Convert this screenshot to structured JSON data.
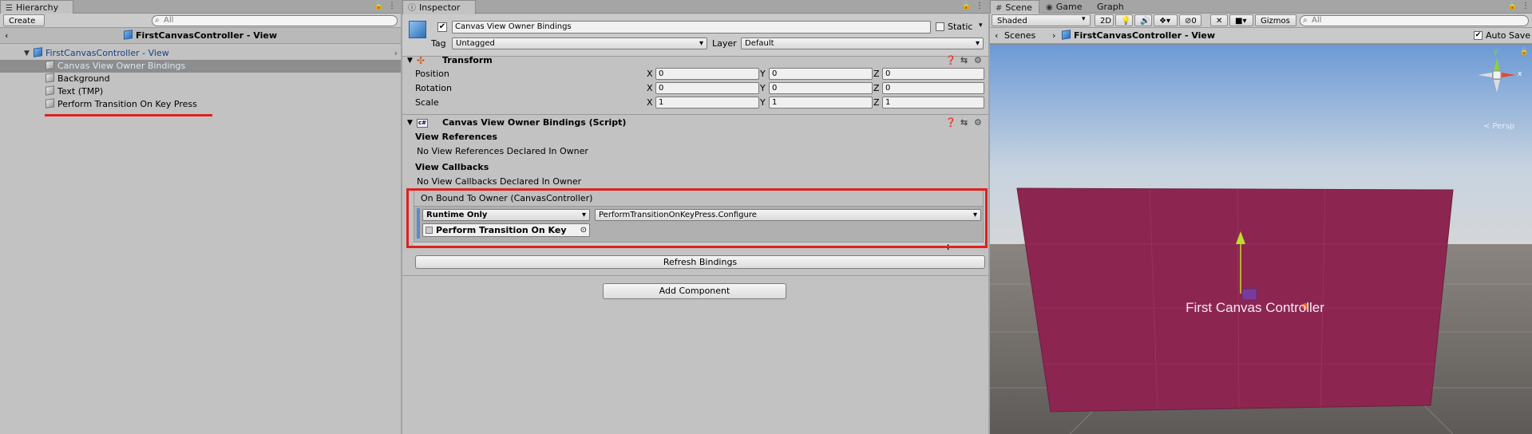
{
  "hierarchy": {
    "tab_label": "Hierarchy",
    "create_label": "Create",
    "search_placeholder": "All",
    "breadcrumb": "FirstCanvasController - View",
    "rows": [
      {
        "label": "FirstCanvasController - View"
      },
      {
        "label": "Canvas View Owner Bindings"
      },
      {
        "label": "Background"
      },
      {
        "label": "Text (TMP)"
      },
      {
        "label": "Perform Transition On Key Press"
      }
    ]
  },
  "inspector": {
    "tab_label": "Inspector",
    "object_name": "Canvas View Owner Bindings",
    "static_label": "Static",
    "tag_label": "Tag",
    "tag_value": "Untagged",
    "layer_label": "Layer",
    "layer_value": "Default",
    "transform": {
      "title": "Transform",
      "position_label": "Position",
      "rotation_label": "Rotation",
      "scale_label": "Scale",
      "x": "X",
      "y": "Y",
      "z": "Z",
      "position": [
        "0",
        "0",
        "0"
      ],
      "rotation": [
        "0",
        "0",
        "0"
      ],
      "scale": [
        "1",
        "1",
        "1"
      ]
    },
    "script": {
      "title": "Canvas View Owner Bindings (Script)",
      "view_refs_header": "View References",
      "view_refs_text": "No View References Declared In Owner",
      "view_callbacks_header": "View Callbacks",
      "view_callbacks_text": "No View Callbacks Declared In Owner",
      "event_title": "On Bound To Owner (CanvasController)",
      "runtime_value": "Runtime Only",
      "function_value": "PerformTransitionOnKeyPress.Configure",
      "object_field": "Perform Transition On Key",
      "plus": "+",
      "minus": "−",
      "refresh_label": "Refresh Bindings"
    },
    "add_component_label": "Add Component"
  },
  "scene": {
    "tabs": [
      "Scene",
      "Game",
      "Graph"
    ],
    "shading_value": "Shaded",
    "mode_2d": "2D",
    "fx_count": "0",
    "gizmos_label": "Gizmos",
    "search_placeholder": "All",
    "scenes_label": "Scenes",
    "breadcrumb": "FirstCanvasController - View",
    "auto_save_label": "Auto Save",
    "persp_label": "Persp",
    "canvas_text": "First Canvas Controller",
    "gizmo_y": "y",
    "gizmo_x": "x",
    "canvas_color": "#8c2650"
  }
}
